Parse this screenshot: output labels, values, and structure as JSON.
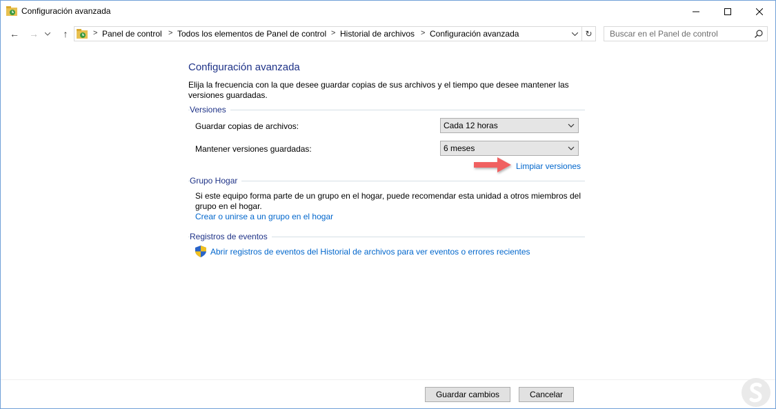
{
  "window": {
    "title": "Configuración avanzada",
    "minimize_glyph": "—",
    "maximize_glyph": "☐",
    "close_glyph": "✕"
  },
  "nav": {
    "back_glyph": "←",
    "forward_glyph": "→",
    "recent_glyph": "⌄",
    "up_glyph": "↑",
    "breadcrumbs": [
      "Panel de control",
      "Todos los elementos de Panel de control",
      "Historial de archivos",
      "Configuración avanzada"
    ],
    "separator": ">",
    "refresh_glyph": "↻",
    "search_placeholder": "Buscar en el Panel de control"
  },
  "main": {
    "heading": "Configuración avanzada",
    "description": "Elija la frecuencia con la que desee guardar copias de sus archivos y el tiempo que desee mantener las versiones guardadas.",
    "versiones": {
      "group_title": "Versiones",
      "save_copies_label": "Guardar copias de archivos:",
      "save_copies_value": "Cada 12 horas",
      "keep_versions_label": "Mantener versiones guardadas:",
      "keep_versions_value": "6 meses",
      "cleanup_link": "Limpiar versiones"
    },
    "grupo_hogar": {
      "group_title": "Grupo Hogar",
      "text": "Si este equipo forma parte de un grupo en el hogar, puede recomendar esta unidad a otros miembros del grupo en el hogar.",
      "link": "Crear o unirse a un grupo en el hogar"
    },
    "registros": {
      "group_title": "Registros de eventos",
      "link": "Abrir registros de eventos del Historial de archivos para ver eventos o errores recientes"
    }
  },
  "footer": {
    "save_button": "Guardar cambios",
    "cancel_button": "Cancelar"
  },
  "colors": {
    "heading": "#1e3287",
    "link": "#0066cc",
    "callout_arrow": "#f06060"
  }
}
